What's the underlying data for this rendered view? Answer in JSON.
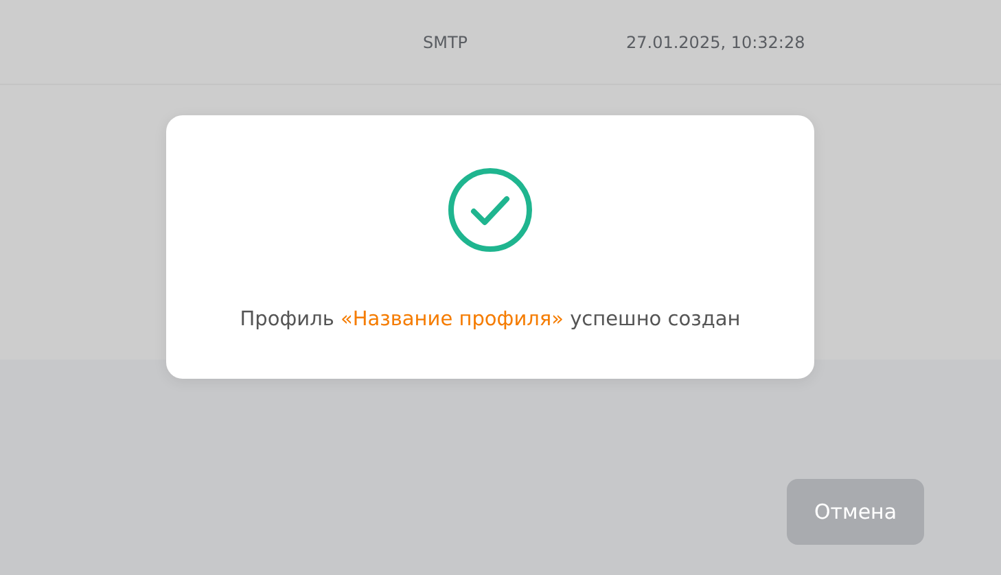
{
  "table": {
    "rows": [
      {
        "protocol": "SMTP",
        "date": "27.01.2025, 10:32:28"
      }
    ]
  },
  "buttons": [
    {
      "label": "Отмена",
      "disabled": true
    }
  ],
  "dialog": {
    "kind": "success",
    "message": "Профиль **«Название профиля»** успешно создан"
  }
}
